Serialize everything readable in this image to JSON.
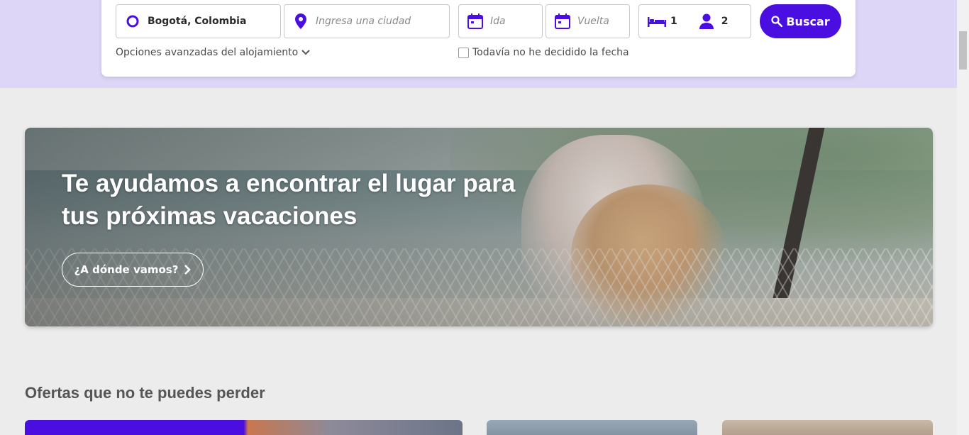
{
  "search": {
    "origin_value": "Bogotá, Colombia",
    "destination_placeholder": "Ingresa una ciudad",
    "ida_placeholder": "Ida",
    "vuelta_placeholder": "Vuelta",
    "rooms_count": "1",
    "guests_count": "2",
    "search_label": "Buscar",
    "advanced_label": "Opciones avanzadas del alojamiento",
    "no_date_label": "Todavía no he decidido la fecha"
  },
  "hero": {
    "title": "Te ayudamos a encontrar el lugar para tus próximas vacaciones",
    "cta_label": "¿A dónde vamos?"
  },
  "offers": {
    "title": "Ofertas que no te puedes perder"
  },
  "colors": {
    "accent": "#4a0ee0",
    "top_band": "#ddd6f6",
    "page_bg": "#ececec"
  },
  "icons": {
    "origin": "circle-icon",
    "destination": "location-pin-icon",
    "date": "calendar-icon",
    "rooms": "bed-icon",
    "guests": "person-icon",
    "search": "magnifier-icon",
    "advanced": "chevron-down-icon",
    "cta": "chevron-right-icon"
  }
}
